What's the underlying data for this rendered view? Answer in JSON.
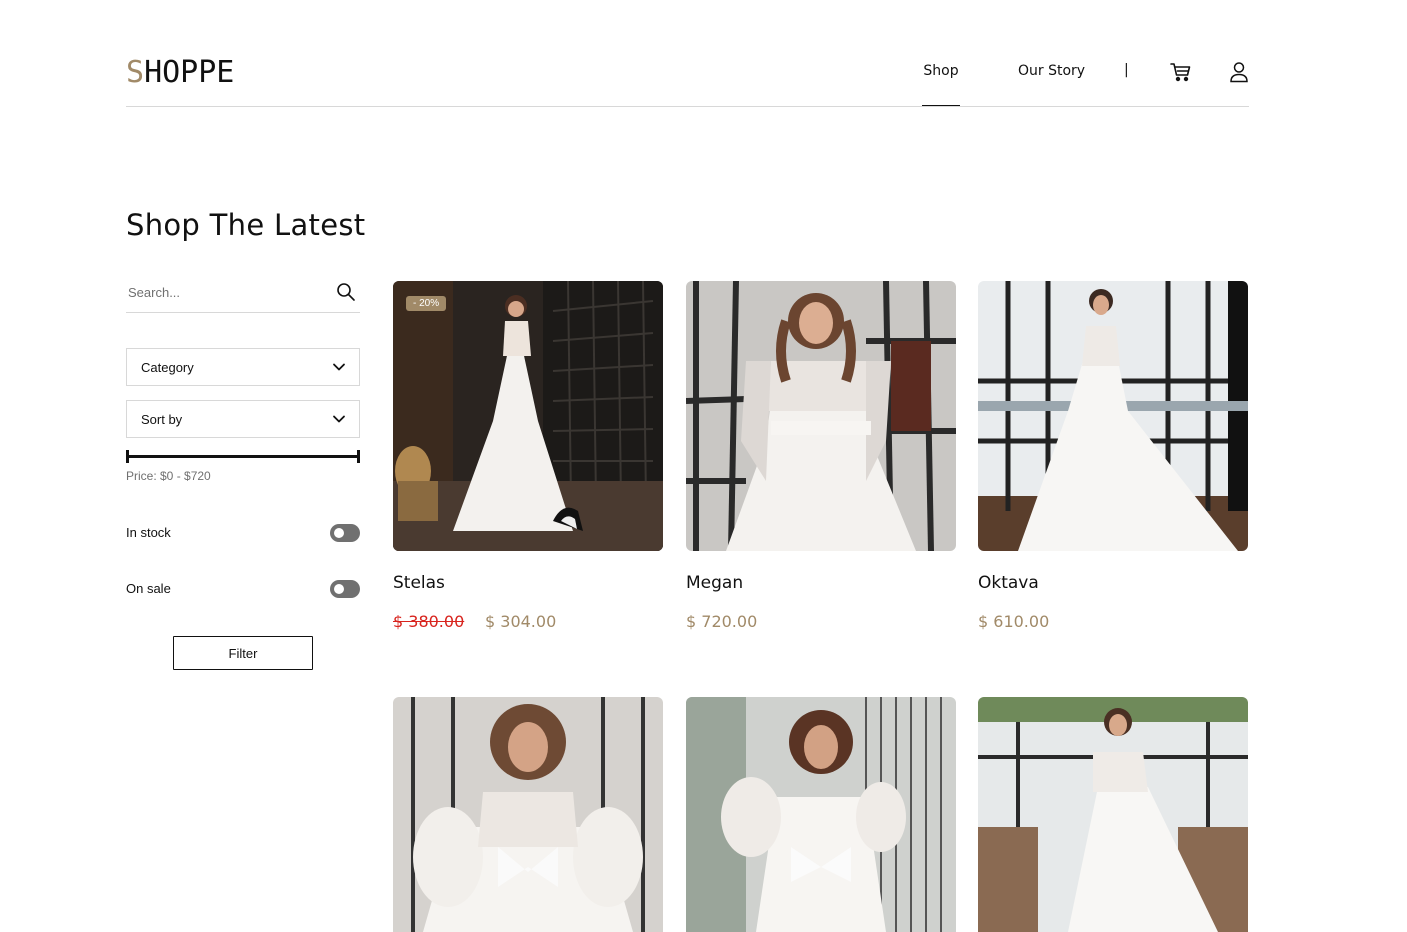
{
  "header": {
    "logo_first": "S",
    "logo_rest": "HOPPE",
    "nav": {
      "shop": "Shop",
      "our_story": "Our Story",
      "separator": "|"
    }
  },
  "page": {
    "title": "Shop The Latest"
  },
  "sidebar": {
    "search": {
      "placeholder": "Search..."
    },
    "category_label": "Category",
    "sort_label": "Sort by",
    "price_label": "Price: $0 - $720",
    "in_stock_label": "In stock",
    "on_sale_label": "On sale",
    "filter_button": "Filter"
  },
  "products": [
    {
      "name": "Stelas",
      "badge": "- 20%",
      "old_price": "$ 380.00",
      "price": "$ 304.00"
    },
    {
      "name": "Megan",
      "price": "$ 720.00"
    },
    {
      "name": "Oktava",
      "price": "$ 610.00"
    },
    {
      "name": ""
    },
    {
      "name": ""
    },
    {
      "name": ""
    }
  ],
  "colors": {
    "accent": "#a18a68",
    "sale_red": "#d8241e",
    "border": "#d8d8d8",
    "text": "#111111",
    "muted": "#707070"
  },
  "icons": {
    "cart": "cart-icon",
    "user": "user-icon",
    "search": "search-icon",
    "chevron": "chevron-down-icon"
  }
}
